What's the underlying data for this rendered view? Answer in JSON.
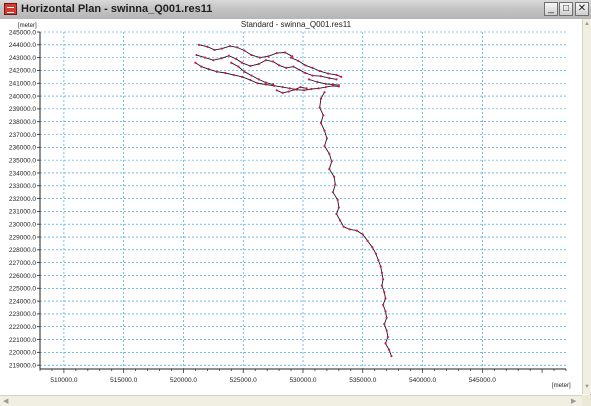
{
  "window": {
    "title": "Horizontal Plan - swinna_Q001.res11",
    "minimize_glyph": "_",
    "maximize_glyph": "□",
    "close_glyph": "✕"
  },
  "chart_data": {
    "type": "scatter",
    "title": "Standard - swinna_Q001.res11",
    "xlabel": "[meter]",
    "ylabel": "[meter]",
    "xlim": [
      508000,
      552000
    ],
    "ylim": [
      218700,
      245000
    ],
    "xticks": [
      510000,
      515000,
      520000,
      525000,
      530000,
      535000,
      540000,
      545000
    ],
    "xtick_labels": [
      "510000.0",
      "515000.0",
      "520000.0",
      "525000.0",
      "530000.0",
      "535000.0",
      "540000.0",
      "545000.0"
    ],
    "yticks": [
      219000,
      220000,
      221000,
      222000,
      223000,
      224000,
      225000,
      226000,
      227000,
      228000,
      229000,
      230000,
      231000,
      232000,
      233000,
      234000,
      235000,
      236000,
      237000,
      238000,
      239000,
      240000,
      241000,
      242000,
      243000,
      244000,
      245000
    ],
    "ytick_labels": [
      "219000.0",
      "220000.0",
      "221000.0",
      "222000.0",
      "223000.0",
      "224000.0",
      "225000.0",
      "226000.0",
      "227000.0",
      "228000.0",
      "229000.0",
      "230000.0",
      "231000.0",
      "232000.0",
      "233000.0",
      "234000.0",
      "235000.0",
      "236000.0",
      "237000.0",
      "238000.0",
      "239000.0",
      "240000.0",
      "241000.0",
      "242000.0",
      "243000.0",
      "244000.0",
      "245000.0"
    ],
    "grid": true,
    "colors": {
      "line": "#1a1a1a",
      "points": "#d4145a",
      "grid": "#2b8de0"
    },
    "series": [
      {
        "points": [
          [
            521300,
            244000
          ],
          [
            522000,
            243850
          ],
          [
            522600,
            243600
          ],
          [
            523200,
            243700
          ],
          [
            523900,
            243900
          ],
          [
            524500,
            243800
          ],
          [
            525100,
            243550
          ],
          [
            525700,
            243200
          ],
          [
            526400,
            243000
          ],
          [
            527100,
            243100
          ],
          [
            527800,
            243350
          ],
          [
            528500,
            243400
          ],
          [
            529100,
            243100
          ]
        ]
      },
      {
        "points": [
          [
            521100,
            243200
          ],
          [
            521800,
            243000
          ],
          [
            522500,
            242800
          ],
          [
            523200,
            242950
          ],
          [
            523800,
            243150
          ],
          [
            524400,
            242900
          ],
          [
            524900,
            242600
          ],
          [
            525600,
            242350
          ],
          [
            526300,
            242500
          ],
          [
            526900,
            242800
          ],
          [
            527500,
            242700
          ],
          [
            528000,
            242400
          ],
          [
            528600,
            242200
          ],
          [
            529200,
            242300
          ],
          [
            529700,
            242050
          ],
          [
            530200,
            241800
          ],
          [
            530800,
            241600
          ],
          [
            531500,
            241550
          ],
          [
            532200,
            241400
          ],
          [
            532800,
            241300
          ]
        ]
      },
      {
        "points": [
          [
            521000,
            242600
          ],
          [
            521500,
            242300
          ],
          [
            522100,
            242100
          ],
          [
            522800,
            241900
          ],
          [
            523500,
            241800
          ],
          [
            524200,
            241650
          ],
          [
            524900,
            241500
          ],
          [
            525600,
            241250
          ],
          [
            526200,
            241000
          ],
          [
            526900,
            240900
          ],
          [
            527600,
            240800
          ],
          [
            528300,
            240700
          ],
          [
            528900,
            240600
          ],
          [
            529500,
            240500
          ],
          [
            530100,
            240450
          ],
          [
            530700,
            240550
          ],
          [
            531300,
            240600
          ],
          [
            531900,
            240700
          ],
          [
            532500,
            240800
          ],
          [
            533000,
            240750
          ]
        ]
      },
      {
        "points": [
          [
            524000,
            242600
          ],
          [
            524600,
            242300
          ],
          [
            525100,
            241900
          ],
          [
            525700,
            241600
          ],
          [
            526300,
            241300
          ],
          [
            526900,
            241050
          ],
          [
            527500,
            240900
          ]
        ]
      },
      {
        "points": [
          [
            529000,
            243000
          ],
          [
            529600,
            242750
          ],
          [
            530200,
            242400
          ],
          [
            530800,
            242200
          ],
          [
            531400,
            241950
          ],
          [
            532100,
            241750
          ],
          [
            532800,
            241650
          ],
          [
            533200,
            241500
          ]
        ]
      },
      {
        "points": [
          [
            527800,
            240450
          ],
          [
            528300,
            240250
          ],
          [
            528800,
            240350
          ],
          [
            529300,
            240500
          ],
          [
            529800,
            240700
          ],
          [
            530300,
            240600
          ]
        ]
      },
      {
        "points": [
          [
            530500,
            241300
          ],
          [
            531200,
            241100
          ],
          [
            531900,
            240950
          ],
          [
            532500,
            240900
          ],
          [
            533000,
            240850
          ]
        ]
      },
      {
        "points": [
          [
            531800,
            240300
          ],
          [
            531500,
            239800
          ],
          [
            531400,
            239100
          ],
          [
            531700,
            238500
          ],
          [
            531500,
            237900
          ],
          [
            531800,
            237300
          ],
          [
            532000,
            236700
          ],
          [
            531800,
            236100
          ],
          [
            532200,
            235500
          ],
          [
            532400,
            234900
          ],
          [
            532200,
            234300
          ],
          [
            532600,
            233700
          ],
          [
            532700,
            233100
          ],
          [
            532500,
            232500
          ],
          [
            532900,
            231900
          ],
          [
            533000,
            231300
          ],
          [
            532800,
            230800
          ],
          [
            533100,
            230300
          ],
          [
            533400,
            229800
          ],
          [
            533900,
            229600
          ],
          [
            534500,
            229500
          ],
          [
            535000,
            229200
          ],
          [
            535400,
            228700
          ],
          [
            535800,
            228200
          ],
          [
            536100,
            227700
          ],
          [
            536300,
            227200
          ],
          [
            536500,
            226700
          ],
          [
            536600,
            226200
          ],
          [
            536700,
            225700
          ],
          [
            536600,
            225200
          ],
          [
            536800,
            224700
          ],
          [
            536900,
            224200
          ],
          [
            536700,
            223700
          ],
          [
            536900,
            223200
          ],
          [
            537000,
            222700
          ],
          [
            536800,
            222200
          ],
          [
            537000,
            221700
          ],
          [
            537100,
            221200
          ],
          [
            536900,
            220700
          ],
          [
            537200,
            220200
          ],
          [
            537400,
            219700
          ]
        ]
      }
    ]
  }
}
